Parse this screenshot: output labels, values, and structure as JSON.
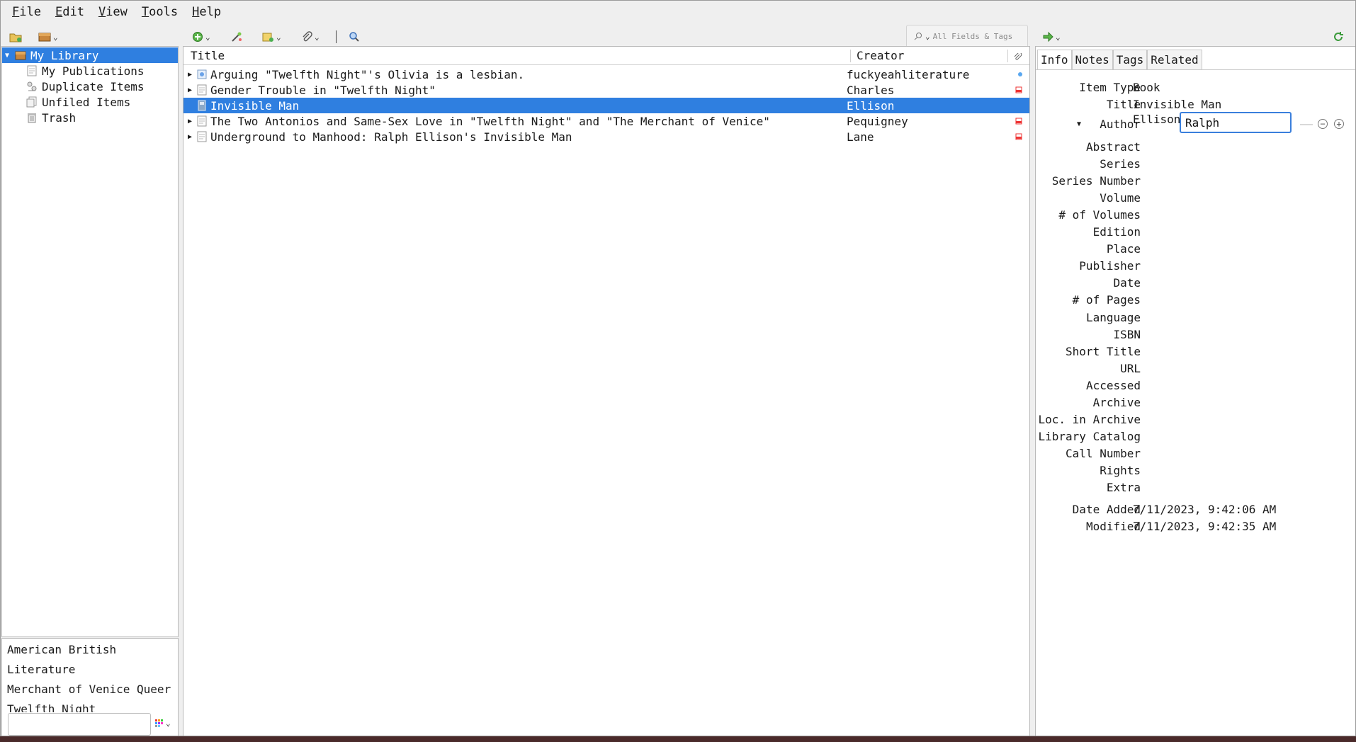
{
  "menu": [
    {
      "accel": "F",
      "rest": "ile"
    },
    {
      "accel": "E",
      "rest": "dit"
    },
    {
      "accel": "V",
      "rest": "iew"
    },
    {
      "accel": "T",
      "rest": "ools"
    },
    {
      "accel": "H",
      "rest": "elp"
    }
  ],
  "toolbar": {
    "search_placeholder": "All Fields & Tags"
  },
  "collections": [
    {
      "label": "My Library",
      "icon": "library-icon",
      "selected": true
    },
    {
      "label": "My Publications",
      "icon": "publications-icon"
    },
    {
      "label": "Duplicate Items",
      "icon": "duplicate-icon"
    },
    {
      "label": "Unfiled Items",
      "icon": "unfiled-icon"
    },
    {
      "label": "Trash",
      "icon": "trash-icon"
    }
  ],
  "tags": [
    "American",
    "British",
    "Literature",
    "Merchant of Venice",
    "Queer",
    "Twelfth Night"
  ],
  "table": {
    "headers": {
      "title": "Title",
      "creator": "Creator"
    },
    "rows": [
      {
        "title": "Arguing \"Twelfth Night\"'s Olivia is a lesbian.",
        "creator": "fuckyeahliterature",
        "icon": "webpage-icon",
        "attach": "dot-icon"
      },
      {
        "title": "Gender Trouble in \"Twelfth Night\"",
        "creator": "Charles",
        "icon": "document-icon",
        "attach": "pdf-icon"
      },
      {
        "title": "Invisible Man",
        "creator": "Ellison",
        "icon": "book-icon",
        "attach": "",
        "selected": true
      },
      {
        "title": "The Two Antonios and Same-Sex Love in \"Twelfth Night\" and \"The Merchant of Venice\"",
        "creator": "Pequigney",
        "icon": "document-icon",
        "attach": "pdf-icon"
      },
      {
        "title": "Underground to Manhood: Ralph Ellison's Invisible Man",
        "creator": "Lane",
        "icon": "document-icon",
        "attach": "pdf-icon"
      }
    ]
  },
  "info": {
    "tabs": [
      "Info",
      "Notes",
      "Tags",
      "Related"
    ],
    "item_type_label": "Item Type",
    "item_type": "Book",
    "title_label": "Title",
    "title": "Invisible Man",
    "author_label": "Author",
    "author_last": "Ellison,",
    "author_first": "Ralph",
    "fields": [
      "Abstract",
      "Series",
      "Series Number",
      "Volume",
      "# of Volumes",
      "Edition",
      "Place",
      "Publisher",
      "Date",
      "# of Pages",
      "Language",
      "ISBN",
      "Short Title",
      "URL",
      "Accessed",
      "Archive",
      "Loc. in Archive",
      "Library Catalog",
      "Call Number",
      "Rights",
      "Extra"
    ],
    "date_added_label": "Date Added",
    "date_added": "7/11/2023, 9:42:06 AM",
    "modified_label": "Modified",
    "modified": "7/11/2023, 9:42:35 AM"
  }
}
